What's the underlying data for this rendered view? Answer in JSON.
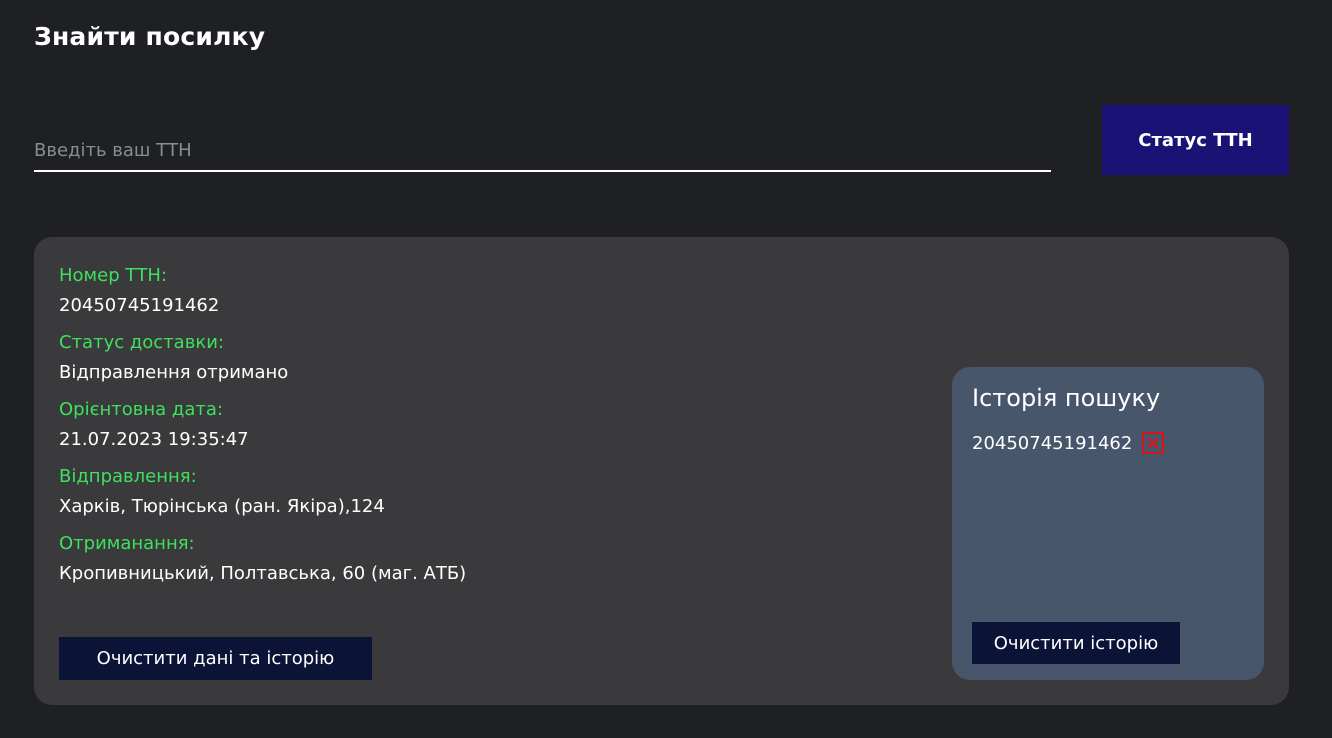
{
  "header": {
    "title": "Знайти посилку"
  },
  "search": {
    "placeholder": "Введіть ваш ТТН",
    "value": "",
    "button_label": "Статус ТТН"
  },
  "result": {
    "fields": [
      {
        "label": "Номер ТТН:",
        "value": "20450745191462"
      },
      {
        "label": "Статус доставки:",
        "value": "Відправлення отримано"
      },
      {
        "label": "Орієнтовна дата:",
        "value": "21.07.2023 19:35:47"
      },
      {
        "label": "Відправлення:",
        "value": "Харків, Тюрінська (ран. Якіра),124"
      },
      {
        "label": "Отриманання:",
        "value": "Кропивницький, Полтавська, 60 (маг. АТБ)"
      }
    ],
    "clear_all_label": "Очистити дані та історію"
  },
  "history": {
    "title": "Історія пошуку",
    "items": [
      {
        "ttn": "20450745191462",
        "remove_icon": "close-icon"
      }
    ],
    "clear_label": "Очистити історію"
  },
  "colors": {
    "background": "#1f2024",
    "card": "#3a3a3c",
    "label_accent": "#3ee05d",
    "primary_button": "#1b1275",
    "dark_button": "#0b1337",
    "history_panel": "#47566b",
    "remove_icon": "#d8151c"
  }
}
